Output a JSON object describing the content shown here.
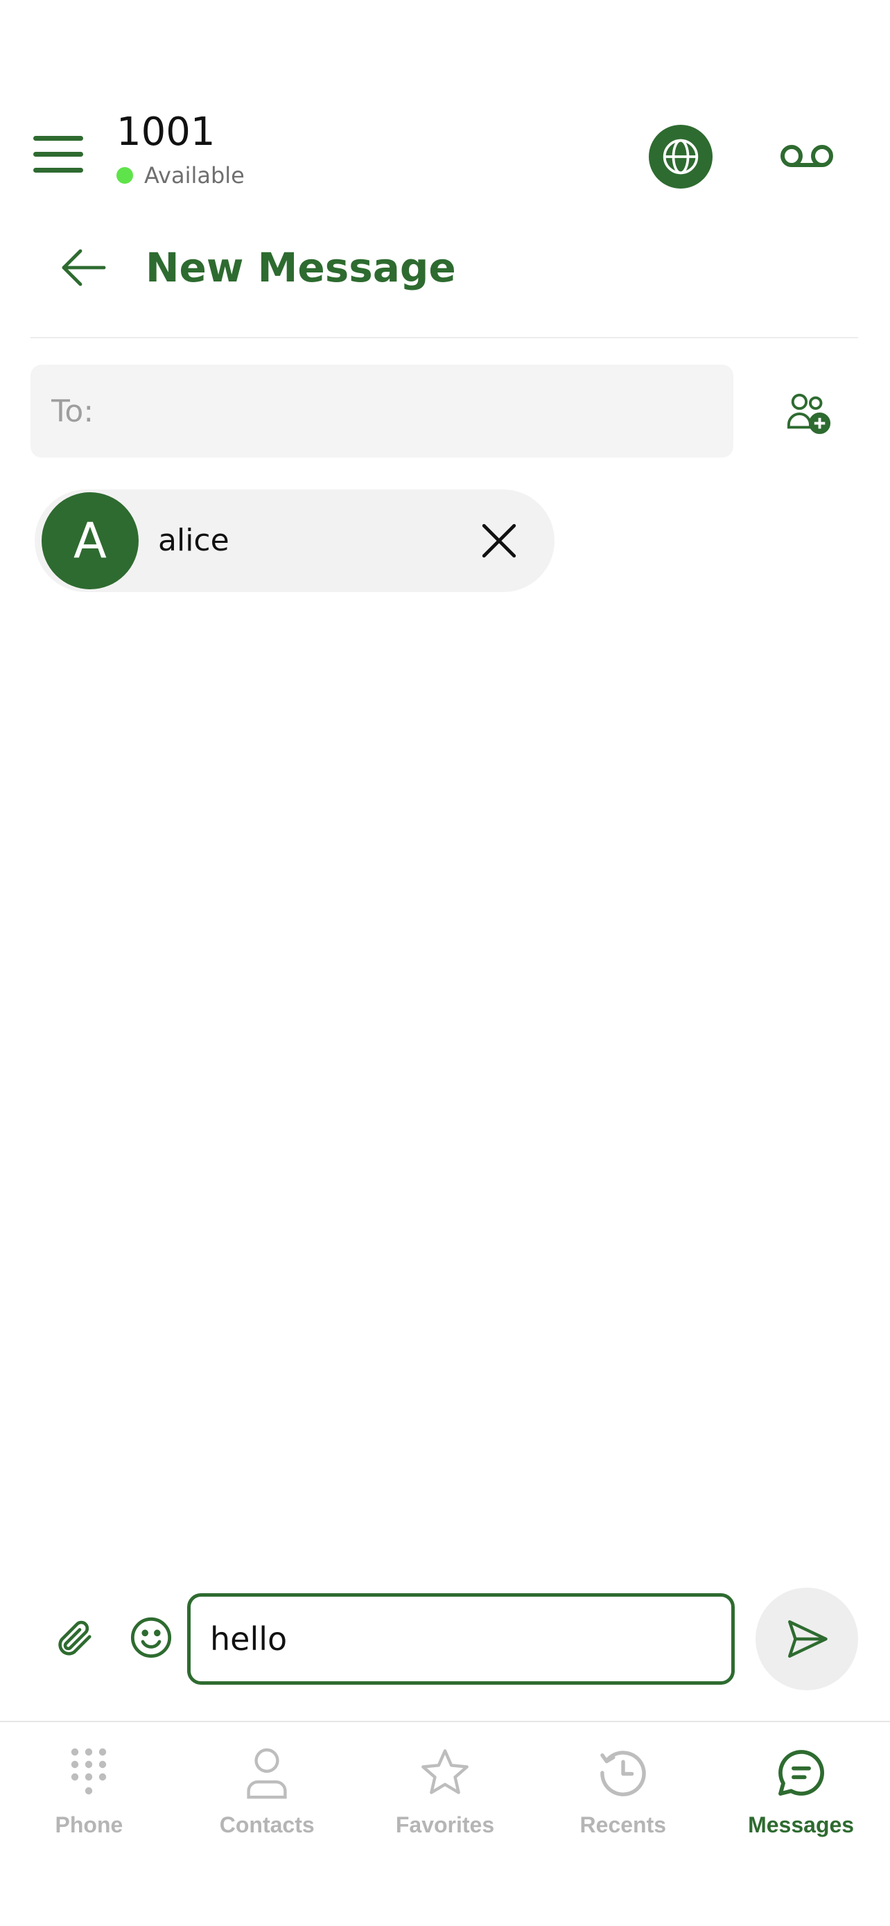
{
  "header": {
    "extension": "1001",
    "status": "Available",
    "status_color": "#5fe34a",
    "menu_icon": "hamburger-icon",
    "globe_icon": "globe-icon",
    "voicemail_icon": "voicemail-icon"
  },
  "title_bar": {
    "title": "New Message",
    "back_icon": "arrow-left-icon"
  },
  "recipient_field": {
    "placeholder": "To:",
    "value": "",
    "add_contact_icon": "add-contact-icon"
  },
  "recipients": [
    {
      "initial": "A",
      "name": "alice"
    }
  ],
  "composer": {
    "value": "hello",
    "attach_icon": "paperclip-icon",
    "emoji_icon": "smiley-icon",
    "send_icon": "send-icon"
  },
  "nav": {
    "items": [
      {
        "label": "Phone",
        "icon": "dialpad-icon",
        "active": false
      },
      {
        "label": "Contacts",
        "icon": "person-icon",
        "active": false
      },
      {
        "label": "Favorites",
        "icon": "star-icon",
        "active": false
      },
      {
        "label": "Recents",
        "icon": "history-icon",
        "active": false
      },
      {
        "label": "Messages",
        "icon": "chat-icon",
        "active": true
      }
    ]
  },
  "colors": {
    "brand": "#2e6b30",
    "inactive": "#b5b5b5"
  }
}
